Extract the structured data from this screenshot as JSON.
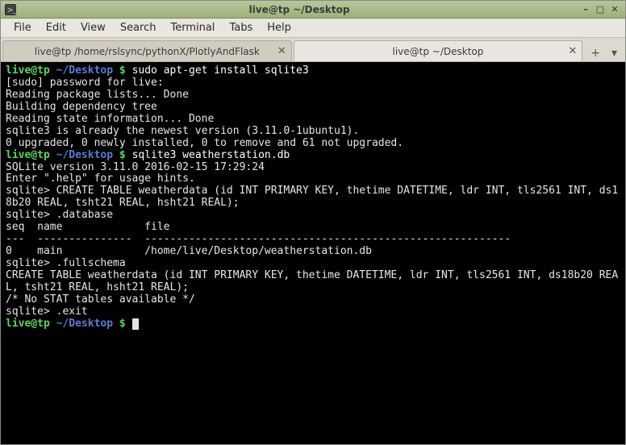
{
  "window": {
    "title": "live@tp ~/Desktop"
  },
  "menubar": {
    "items": [
      "File",
      "Edit",
      "View",
      "Search",
      "Terminal",
      "Tabs",
      "Help"
    ]
  },
  "tabs": {
    "items": [
      {
        "label": "live@tp /home/rslsync/pythonX/PlotlyAndFlask",
        "active": false
      },
      {
        "label": "live@tp ~/Desktop",
        "active": true
      }
    ],
    "new_tab_glyph": "+",
    "dropdown_glyph": "▾"
  },
  "win_controls": {
    "minimize": "–",
    "maximize": "□",
    "close": "✕"
  },
  "terminal": {
    "prompt_user_host": "live@tp",
    "prompt_path": "~/Desktop",
    "prompt_symbol": "$",
    "lines": {
      "cmd1": "sudo apt-get install sqlite3",
      "out1": "[sudo] password for live:",
      "out2": "Reading package lists... Done",
      "out3": "Building dependency tree",
      "out4": "Reading state information... Done",
      "out5": "sqlite3 is already the newest version (3.11.0-1ubuntu1).",
      "out6": "0 upgraded, 0 newly installed, 0 to remove and 61 not upgraded.",
      "cmd2": "sqlite3 weatherstation.db",
      "out7": "SQLite version 3.11.0 2016-02-15 17:29:24",
      "out8": "Enter \".help\" for usage hints.",
      "out9": "sqlite> CREATE TABLE weatherdata (id INT PRIMARY KEY, thetime DATETIME, ldr INT, tls2561 INT, ds18b20 REAL, tsht21 REAL, hsht21 REAL);",
      "out10": "sqlite> .database",
      "out11": "seq  name             file",
      "out12": "---  ---------------  ----------------------------------------------------------",
      "out13": "0    main             /home/live/Desktop/weatherstation.db",
      "out14": "sqlite> .fullschema",
      "out15": "CREATE TABLE weatherdata (id INT PRIMARY KEY, thetime DATETIME, ldr INT, tls2561 INT, ds18b20 REAL, tsht21 REAL, hsht21 REAL);",
      "out16": "/* No STAT tables available */",
      "out17": "sqlite> .exit"
    }
  }
}
